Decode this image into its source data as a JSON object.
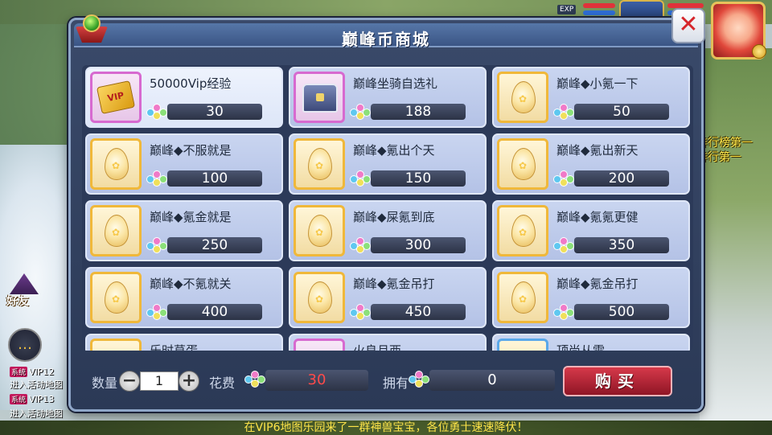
{
  "window": {
    "title": "巅峰币商城"
  },
  "hud": {
    "exp_label": "EXP",
    "rank_line_1": "排行榜第一",
    "rank_line_2": "排行第一",
    "friend_label": "好友",
    "chat_lines": [
      {
        "tag": "系统",
        "text": "VIP12"
      },
      {
        "tag": "",
        "text": "进入活动地图"
      },
      {
        "tag": "系统",
        "text": "VIP13"
      },
      {
        "tag": "",
        "text": "进入活动地图"
      }
    ],
    "marquee": "在VIP6地图乐园来了一群神兽宝宝，各位勇士速速降伏！"
  },
  "shop": {
    "items": [
      {
        "name": "50000Vip经验",
        "price": "30",
        "icon": "vip-card-icon",
        "selected": true
      },
      {
        "name": "巅峰坐骑自选礼",
        "price": "188",
        "icon": "treasure-chest-icon",
        "selected": false
      },
      {
        "name": "巅峰◆小氪一下",
        "price": "50",
        "icon": "egg-icon",
        "selected": false
      },
      {
        "name": "巅峰◆不服就是",
        "price": "100",
        "icon": "egg-icon",
        "selected": false
      },
      {
        "name": "巅峰◆氪出个天",
        "price": "150",
        "icon": "egg-icon",
        "selected": false
      },
      {
        "name": "巅峰◆氪出新天",
        "price": "200",
        "icon": "egg-icon",
        "selected": false
      },
      {
        "name": "巅峰◆氪金就是",
        "price": "250",
        "icon": "egg-icon",
        "selected": false
      },
      {
        "name": "巅峰◆屎氪到底",
        "price": "300",
        "icon": "egg-icon",
        "selected": false
      },
      {
        "name": "巅峰◆氪氪更健",
        "price": "350",
        "icon": "egg-icon",
        "selected": false
      },
      {
        "name": "巅峰◆不氪就关",
        "price": "400",
        "icon": "egg-icon",
        "selected": false
      },
      {
        "name": "巅峰◆氪金吊打",
        "price": "450",
        "icon": "egg-icon",
        "selected": false
      },
      {
        "name": "巅峰◆氪金吊打",
        "price": "500",
        "icon": "egg-icon",
        "selected": false
      }
    ],
    "partial_row_names": [
      "乐时草蛋",
      "火良月西",
      "顶尚从雷"
    ]
  },
  "purchase": {
    "qty_label": "数量",
    "qty_value": "1",
    "cost_label": "花费",
    "cost_value": "30",
    "own_label": "拥有",
    "own_value": "0",
    "buy_label": "购买"
  },
  "colors": {
    "accent_red": "#d6394a",
    "cost_text": "#ff4a4a",
    "item_bg": "#c9d5f0",
    "egg_frame": "#f0b83a",
    "special_frame": "#d76ad0"
  }
}
